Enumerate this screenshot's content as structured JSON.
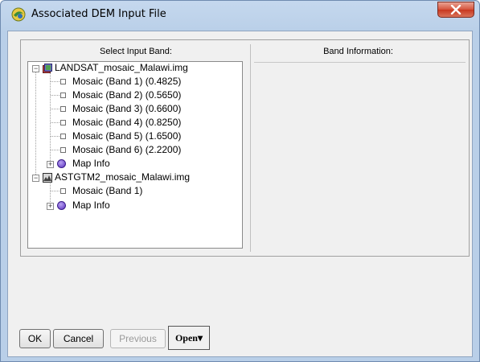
{
  "window": {
    "title": "Associated DEM Input File"
  },
  "left_panel": {
    "header": "Select Input Band:"
  },
  "right_panel": {
    "header": "Band Information:"
  },
  "tree": {
    "file1": {
      "name": "LANDSAT_mosaic_Malawi.img",
      "bands": [
        "Mosaic (Band 1) (0.4825)",
        "Mosaic (Band 2) (0.5650)",
        "Mosaic (Band 3) (0.6600)",
        "Mosaic (Band 4) (0.8250)",
        "Mosaic (Band 5) (1.6500)",
        "Mosaic (Band 6) (2.2200)"
      ],
      "map_info": "Map Info"
    },
    "file2": {
      "name": "ASTGTM2_mosaic_Malawi.img",
      "bands": [
        "Mosaic (Band 1)"
      ],
      "map_info": "Map Info"
    }
  },
  "buttons": {
    "ok": "OK",
    "cancel": "Cancel",
    "previous": "Previous",
    "open": "Open"
  },
  "icons": {
    "expand_symbol": "−",
    "collapse_symbol": "+",
    "dropdown_arrow": "▾"
  },
  "colors": {
    "titlebar": "#b9cfe8",
    "close_button": "#c8371f",
    "dialog_bg": "#f0f0f0"
  }
}
